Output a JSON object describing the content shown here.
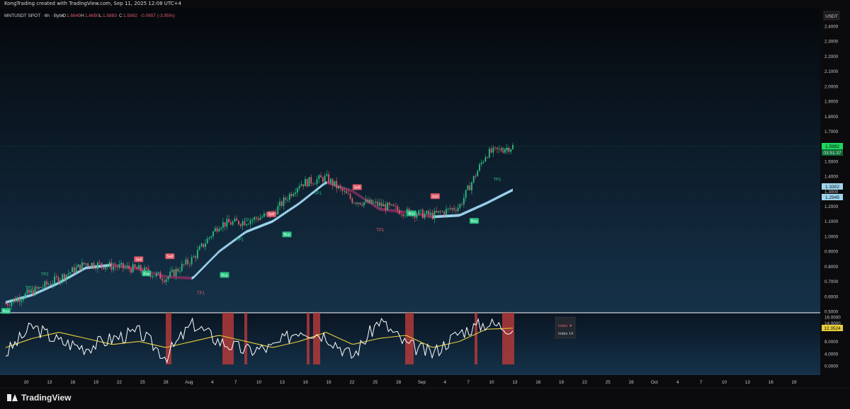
{
  "header": {
    "attribution": "KongTrading created with TradingView.com, Sep 11, 2025 12:08 UTC+4",
    "symbol": "MNTUSDT SPOT · 6h · Bybit",
    "open_label": "O",
    "open": "1.6649",
    "high_label": "H",
    "high": "1.6650",
    "low_label": "L",
    "low": "1.5883",
    "close_label": "C",
    "close": "1.5992",
    "change": "-0.0657 (-3.95%)"
  },
  "price_axis": {
    "currency": "USDT",
    "ticks": [
      "2.4000",
      "2.3000",
      "2.2000",
      "2.1000",
      "2.0000",
      "1.9000",
      "1.8000",
      "1.7000",
      "1.5000",
      "1.4000",
      "1.3000",
      "1.2000",
      "1.1000",
      "1.0000",
      "0.9000",
      "0.8000",
      "0.7000",
      "0.6000",
      "0.5000"
    ],
    "last_price": "1.5992",
    "countdown": "03:51:37",
    "label_upper": "1.3302",
    "label_lower": "1.2945"
  },
  "indicator_axis": {
    "ticks": [
      "16.0000",
      "14.0000",
      "12.0000",
      "8.0000",
      "4.0000",
      "0.0000"
    ],
    "value_label": "12.3524"
  },
  "legend": {
    "item1": "Index",
    "item2": "Index 14"
  },
  "time_axis": {
    "labels": [
      "10",
      "13",
      "16",
      "19",
      "22",
      "25",
      "28",
      "Aug",
      "4",
      "7",
      "10",
      "13",
      "16",
      "19",
      "22",
      "25",
      "28",
      "Sep",
      "4",
      "7",
      "10",
      "13",
      "16",
      "19",
      "22",
      "25",
      "28",
      "Oct",
      "4",
      "7",
      "10",
      "13",
      "16",
      "19"
    ]
  },
  "signals": {
    "buy": "Buy",
    "sell": "Sell",
    "tp1": "TP1",
    "tp2": "TP2"
  },
  "colors": {
    "up": "#26c281",
    "down": "#e05a6a",
    "ribbon_light": "#9fd4ee",
    "ribbon_dark": "#7a2a5a",
    "indicator_line": "#ffffff",
    "indicator_ma": "#e8cf3a",
    "zone": "#b23a3a",
    "last_price": "#1ed760"
  },
  "footer": {
    "brand": "TradingView"
  },
  "chart_data": {
    "type": "line",
    "x_unit": "6h bar",
    "price": {
      "x": [
        "Jul 8",
        "Jul 12",
        "Jul 16",
        "Jul 20",
        "Jul 24",
        "Jul 28",
        "Aug 1",
        "Aug 4",
        "Aug 7",
        "Aug 10",
        "Aug 13",
        "Aug 16",
        "Aug 20",
        "Aug 24",
        "Aug 28",
        "Sep 1",
        "Sep 4",
        "Sep 7",
        "Sep 10",
        "Sep 11"
      ],
      "close": [
        0.55,
        0.63,
        0.72,
        0.82,
        0.8,
        0.78,
        0.72,
        0.85,
        1.08,
        1.1,
        1.15,
        1.35,
        1.39,
        1.24,
        1.21,
        1.16,
        1.14,
        1.2,
        1.55,
        1.5992
      ],
      "ylim": [
        0.5,
        2.45
      ]
    },
    "ribbon": {
      "x": [
        "Jul 8",
        "Jul 12",
        "Jul 16",
        "Jul 20",
        "Jul 24",
        "Jul 28",
        "Aug 1",
        "Aug 4",
        "Aug 7",
        "Aug 10",
        "Aug 13",
        "Aug 16",
        "Aug 20",
        "Aug 24",
        "Aug 28",
        "Sep 1",
        "Sep 4",
        "Sep 7",
        "Sep 10",
        "Sep 11"
      ],
      "values": [
        0.56,
        0.61,
        0.69,
        0.79,
        0.81,
        0.78,
        0.73,
        0.72,
        0.9,
        1.03,
        1.1,
        1.22,
        1.36,
        1.3,
        1.18,
        1.16,
        1.13,
        1.14,
        1.22,
        1.31
      ]
    },
    "indicator": {
      "x": [
        "Jul 8",
        "Jul 12",
        "Jul 16",
        "Jul 20",
        "Jul 24",
        "Jul 28",
        "Aug 1",
        "Aug 4",
        "Aug 7",
        "Aug 10",
        "Aug 13",
        "Aug 16",
        "Aug 20",
        "Aug 24",
        "Aug 28",
        "Sep 1",
        "Sep 4",
        "Sep 7",
        "Sep 10",
        "Sep 11"
      ],
      "values": [
        4,
        13,
        8,
        6,
        9,
        11,
        3,
        14,
        8,
        5,
        6,
        12,
        10,
        3,
        15,
        7,
        4,
        11,
        14,
        12.35
      ],
      "ma": [
        6,
        9,
        11,
        9,
        7,
        8,
        6,
        8,
        10,
        8,
        6,
        8,
        11,
        7,
        9,
        10,
        6,
        8,
        12,
        12.35
      ],
      "ylim": [
        -1,
        16
      ]
    },
    "signals": [
      {
        "type": "Buy",
        "date": "Jul 8",
        "price": 0.55
      },
      {
        "type": "TP1",
        "date": "Jul 11",
        "price": 0.63
      },
      {
        "type": "TP2",
        "date": "Jul 13",
        "price": 0.72
      },
      {
        "type": "Sell",
        "date": "Jul 25",
        "price": 0.8
      },
      {
        "type": "Buy",
        "date": "Jul 26",
        "price": 0.8
      },
      {
        "type": "Sell",
        "date": "Jul 29",
        "price": 0.82
      },
      {
        "type": "TP1",
        "date": "Aug 2",
        "price": 0.66
      },
      {
        "type": "Buy",
        "date": "Aug 5",
        "price": 0.79
      },
      {
        "type": "TP1",
        "date": "Aug 7",
        "price": 0.95
      },
      {
        "type": "TP2",
        "date": "Aug 8",
        "price": 1.08
      },
      {
        "type": "Sell",
        "date": "Aug 11",
        "price": 1.1
      },
      {
        "type": "Buy",
        "date": "Aug 13",
        "price": 1.06
      },
      {
        "type": "TP1",
        "date": "Aug 17",
        "price": 1.26
      },
      {
        "type": "Sell",
        "date": "Aug 22",
        "price": 1.28
      },
      {
        "type": "TP1",
        "date": "Aug 25",
        "price": 1.08
      },
      {
        "type": "Buy",
        "date": "Aug 29",
        "price": 1.2
      },
      {
        "type": "Sell",
        "date": "Sep 1",
        "price": 1.22
      },
      {
        "type": "Buy",
        "date": "Sep 6",
        "price": 1.15
      },
      {
        "type": "TP1",
        "date": "Sep 9",
        "price": 1.35
      },
      {
        "type": "TP2",
        "date": "Sep 10",
        "price": 1.55
      }
    ]
  }
}
